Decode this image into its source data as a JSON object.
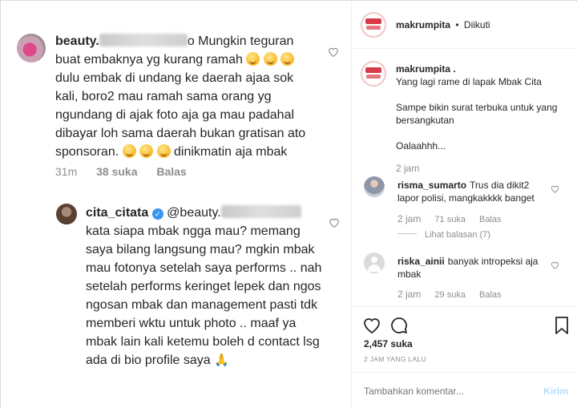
{
  "left_comments": [
    {
      "username": "beauty.",
      "text_parts": [
        "Mungkin teguran buat embaknya yg kurang ramah",
        "dulu embak di undang ke daerah ajaa sok kali, boro2 mau ramah sama orang yg ngundang di ajak foto aja ga mau padahal dibayar loh sama daerah bukan gratisan ato sponsoran.",
        "dinikmatin aja mbak"
      ],
      "time": "31m",
      "likes": "38 suka",
      "reply": "Balas"
    },
    {
      "username": "cita_citata",
      "mention": "@beauty.",
      "text": "kata siapa mbak ngga mau? memang saya bilang langsung mau? mgkin mbak mau fotonya setelah saya performs .. nah setelah performs keringet lepek dan ngos ngosan mbak dan management pasti tdk memberi wktu untuk photo .. maaf ya mbak lain kali ketemu boleh d contact lsg ada di bio profile saya",
      "emoji": "🙏"
    }
  ],
  "post": {
    "account": "makrumpita",
    "separator": "•",
    "follow_status": "Diikuti",
    "caption": {
      "username": "makrumpita .",
      "line1": "Yang lagi rame di lapak Mbak Cita",
      "line2": "Sampe bikin surat terbuka untuk yang bersangkutan",
      "line3": "Oalaahhh...",
      "time": "2 jam"
    },
    "comments": [
      {
        "username": "risma_sumarto",
        "text": "Trus dia dikit2 lapor polisi, mangkakkkk banget",
        "time": "2 jam",
        "likes": "71 suka",
        "reply": "Balas"
      },
      {
        "username": "riska_ainii",
        "text": "banyak intropeksi aja mbak",
        "time": "2 jam",
        "likes": "29 suka",
        "reply": "Balas"
      }
    ],
    "view_replies": "Lihat balasan (7)",
    "likes_count": "2,457",
    "likes_label": "suka",
    "post_time": "2 JAM YANG LALU",
    "comment_placeholder": "Tambahkan komentar...",
    "post_button": "Kirim"
  },
  "colors": {
    "link_blue": "#b2dffc",
    "verified": "#3897f0",
    "muted": "#8e8e8e"
  }
}
